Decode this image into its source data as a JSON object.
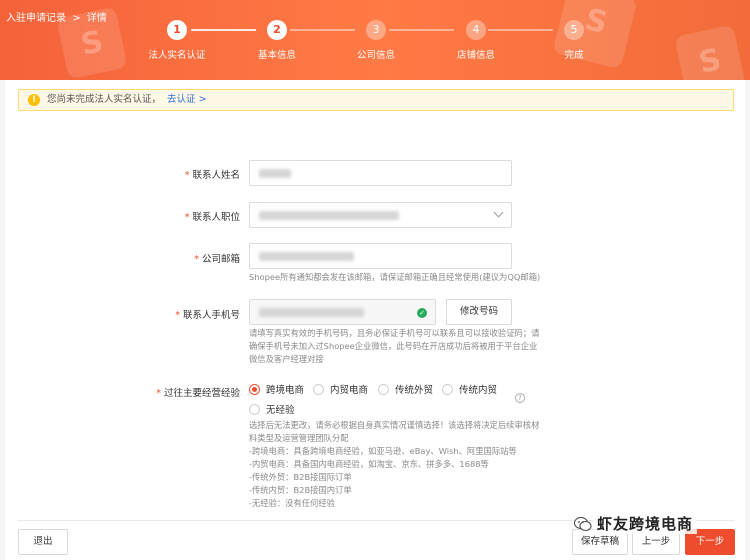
{
  "breadcrumb": {
    "parent": "入驻申请记录",
    "separator": ">",
    "current": "详情"
  },
  "steps": [
    {
      "number": "1",
      "label": "法人实名认证"
    },
    {
      "number": "2",
      "label": "基本信息"
    },
    {
      "number": "3",
      "label": "公司信息"
    },
    {
      "number": "4",
      "label": "店铺信息"
    },
    {
      "number": "5",
      "label": "完成"
    }
  ],
  "notice": {
    "icon": "!",
    "text": "您尚未完成法人实名认证，",
    "link": "去认证",
    "link_arrow": ">"
  },
  "form": {
    "required_mark": "*",
    "contact_name": {
      "label": "联系人姓名"
    },
    "contact_position": {
      "label": "联系人职位"
    },
    "company_email": {
      "label": "公司邮箱",
      "helper": "Shopee所有通知都会发在该邮箱，请保证邮箱正确且经常使用(建议为QQ邮箱)"
    },
    "contact_phone": {
      "label": "联系人手机号",
      "verified_icon": "✓",
      "change_button": "修改号码",
      "helper_lines": [
        "请填写真实有效的手机号码，且务必保证手机号可以联系且可以接收验证码；请",
        "确保手机号未加入过Shopee企业微信，此号码在开店成功后将被用于平台企业",
        "微信及客户经理对接"
      ]
    },
    "experience": {
      "label": "过往主要经营经验",
      "options": [
        "跨境电商",
        "内贸电商",
        "传统外贸",
        "传统内贸",
        "无经验"
      ],
      "selected": "跨境电商",
      "help_icon": "?",
      "helper_lines": [
        "选择后无法更改，请务必根据自身真实情况谨慎选择！该选择将决定后续审核材",
        "料类型及运营管理团队分配",
        "-跨境电商：具备跨境电商经验，如亚马逊、eBay、Wish、阿里国际站等",
        "-内贸电商：具备国内电商经验，如淘宝、京东、拼多多、1688等",
        "-传统外贸：B2B接国际订单",
        "-传统内贸：B2B接国内订单",
        "-无经验：没有任何经验"
      ]
    }
  },
  "footer": {
    "exit": "退出",
    "save_draft": "保存草稿",
    "prev": "上一步",
    "next": "下一步"
  },
  "watermark": {
    "text": "虾友跨境电商"
  },
  "colors": {
    "brand": "#ee4d2d",
    "header_start": "#f4623a",
    "notice_bg": "#fff8e6",
    "link": "#2f6fd9",
    "verified": "#26aa5c"
  }
}
